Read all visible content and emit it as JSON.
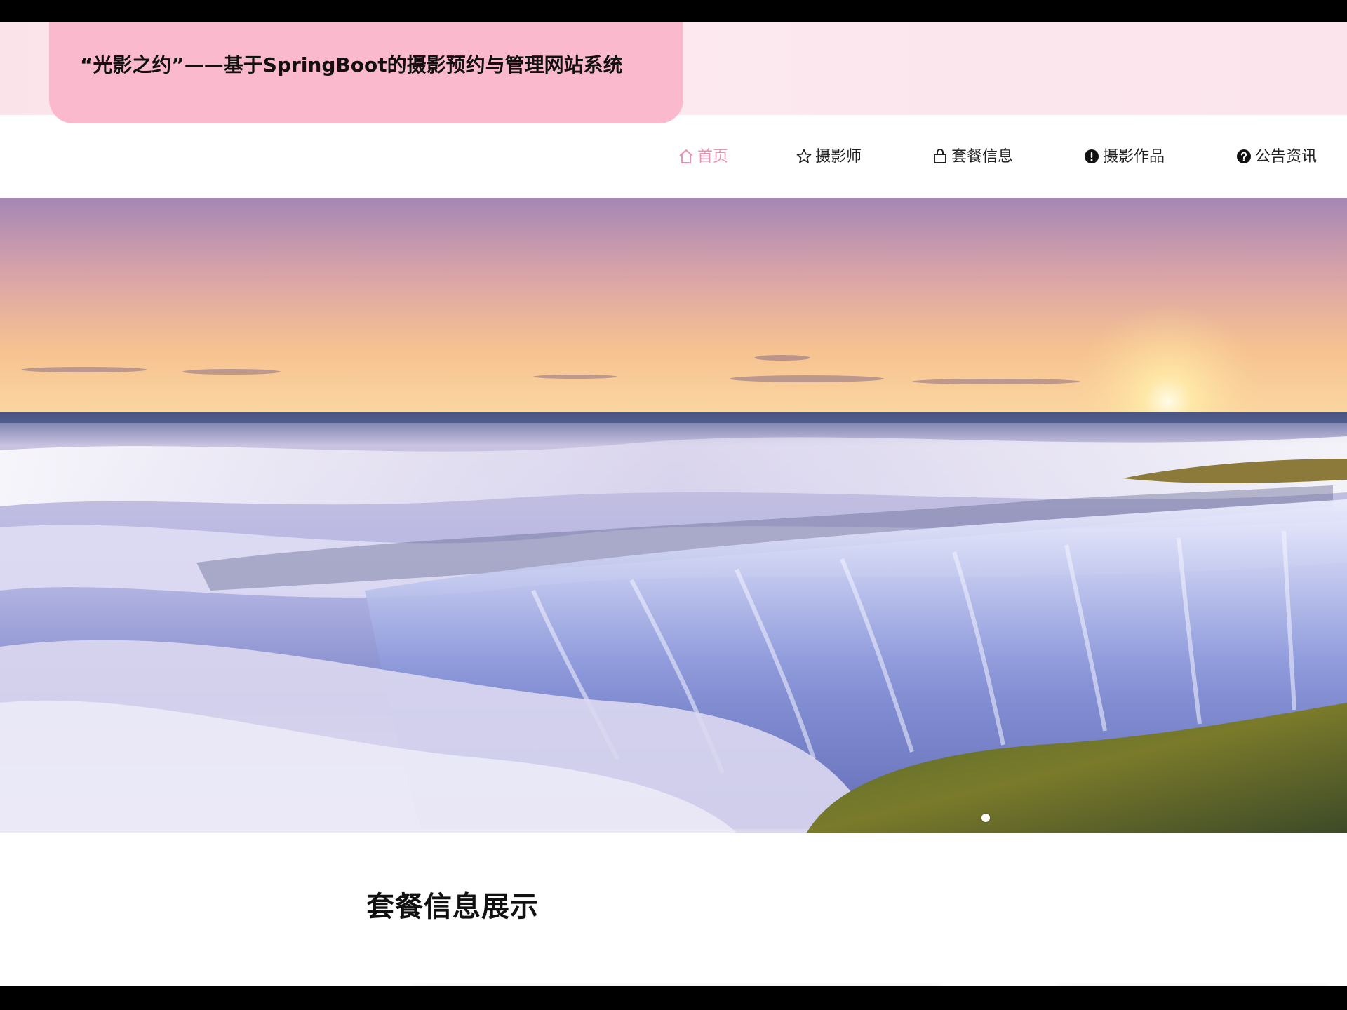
{
  "header": {
    "site_title": "“光影之约”——基于SpringBoot的摄影预约与管理网站系统"
  },
  "nav": {
    "items": [
      {
        "label": "首页",
        "icon": "home-icon",
        "active": true
      },
      {
        "label": "摄影师",
        "icon": "star-icon",
        "active": false
      },
      {
        "label": "套餐信息",
        "icon": "bag-icon",
        "active": false
      },
      {
        "label": "摄影作品",
        "icon": "info-circle-icon",
        "active": false
      },
      {
        "label": "公告资讯",
        "icon": "question-circle-icon",
        "active": false
      }
    ],
    "active_color": "#f08fae"
  },
  "hero": {
    "slide_count": 1,
    "current_slide": 1
  },
  "section": {
    "title": "套餐信息展示"
  },
  "colors": {
    "title_tab": "#fbb9cd",
    "title_strip": "#fde9f0"
  }
}
